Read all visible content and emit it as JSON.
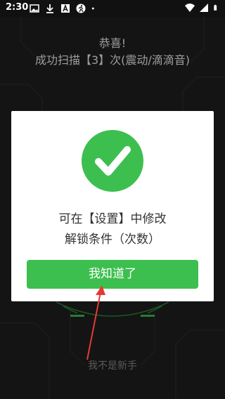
{
  "status_bar": {
    "time": "2:30",
    "icons_left": [
      "image-icon",
      "download-icon",
      "text-a-icon",
      "running-person-icon",
      "dot-icon"
    ],
    "icons_right": [
      "wifi-icon",
      "signal-icon",
      "battery-icon"
    ]
  },
  "background": {
    "title_line1": "恭喜!",
    "title_line2": "成功扫描【3】次(震动/滴滴音)",
    "not_newbie_link": "我不是新手"
  },
  "dialog": {
    "icon": "checkmark-icon",
    "message_line1": "可在【设置】中修改",
    "message_line2": "解锁条件（次数）",
    "ok_button_label": "我知道了"
  },
  "colors": {
    "accent_green": "#3dbf4f",
    "background": "#141414",
    "pointer_red": "#e53935"
  }
}
